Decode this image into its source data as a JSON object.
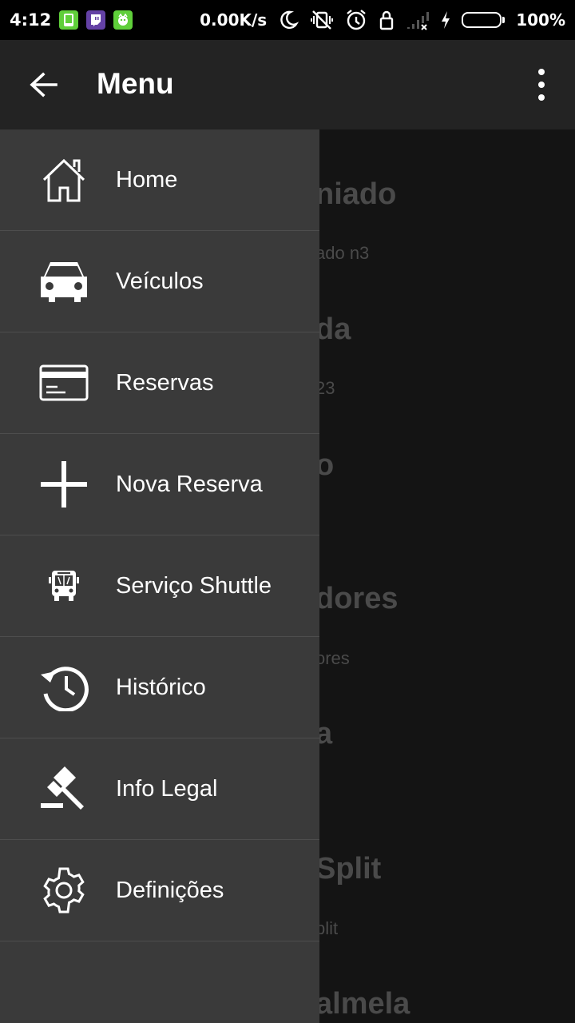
{
  "status_bar": {
    "time": "4:12",
    "net_speed": "0.00K/s",
    "battery": "100%",
    "battery_level": 1.0
  },
  "app_bar": {
    "title": "Menu",
    "back_icon": "arrow-back-icon",
    "overflow_icon": "more-vert-icon"
  },
  "drawer": {
    "items": [
      {
        "label": "Home",
        "icon": "home-icon"
      },
      {
        "label": "Veículos",
        "icon": "car-icon"
      },
      {
        "label": "Reservas",
        "icon": "card-icon"
      },
      {
        "label": "Nova Reserva",
        "icon": "plus-icon"
      },
      {
        "label": "Serviço Shuttle",
        "icon": "bus-icon"
      },
      {
        "label": "Histórico",
        "icon": "history-icon"
      },
      {
        "label": "Info Legal",
        "icon": "gavel-icon"
      },
      {
        "label": "Definições",
        "icon": "gear-icon"
      }
    ]
  },
  "background": {
    "items": [
      {
        "text": "niado"
      },
      {
        "text": "ado n3"
      },
      {
        "text": "da"
      },
      {
        "text": "23"
      },
      {
        "text": "o"
      },
      {
        "text": "dores"
      },
      {
        "text": "ores"
      },
      {
        "text": "a"
      },
      {
        "text": "Split"
      },
      {
        "text": "plit"
      },
      {
        "text": "almela"
      }
    ]
  },
  "colors": {
    "app_bar": "#232323",
    "drawer": "#3a3a3a",
    "divider": "#4d4d4d",
    "scrim_bg": "#141414",
    "battery_fill": "#52d62b"
  }
}
